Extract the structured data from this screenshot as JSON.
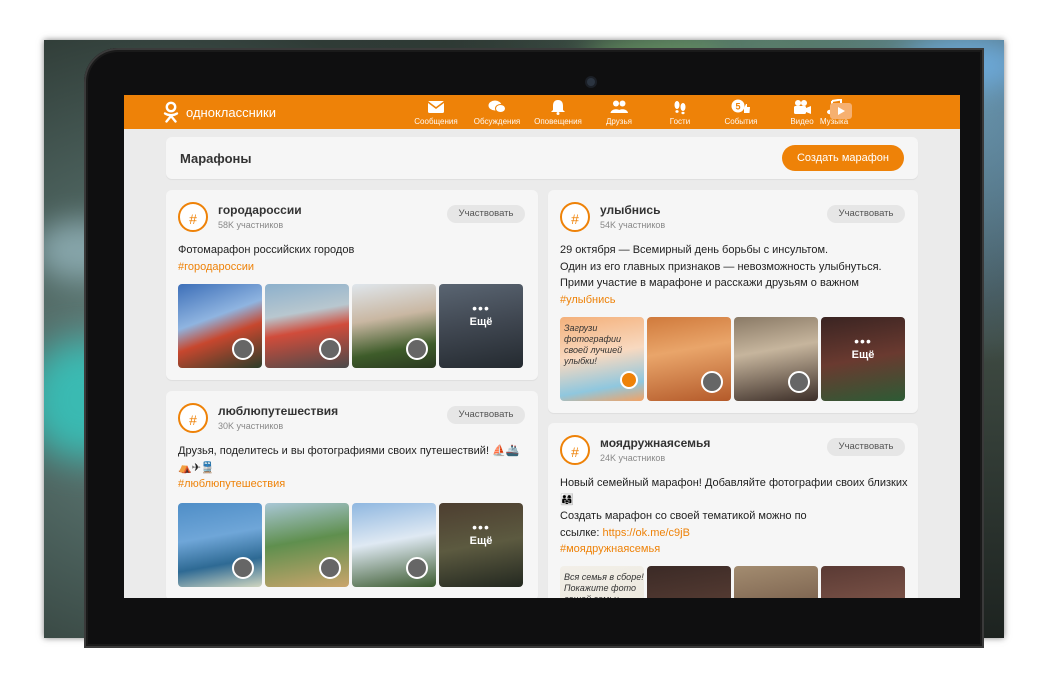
{
  "app": {
    "logo_text": "одноклассники",
    "brand_color": "#ee8208"
  },
  "nav": [
    {
      "label": "Сообщения",
      "icon": "envelope-icon"
    },
    {
      "label": "Обсуждения",
      "icon": "chat-bubbles-icon"
    },
    {
      "label": "Оповещения",
      "icon": "bell-icon"
    },
    {
      "label": "Друзья",
      "icon": "friends-icon"
    },
    {
      "label": "Гости",
      "icon": "footprints-icon"
    },
    {
      "label": "События",
      "icon": "events-icon",
      "badge": "5"
    },
    {
      "label": "Видео",
      "icon": "video-camera-icon"
    },
    {
      "label": "Музыка",
      "icon": "music-note-icon"
    }
  ],
  "page": {
    "title": "Марафоны",
    "create_button": "Создать марафон"
  },
  "cards": [
    {
      "name": "городароссии",
      "members": "58K участников",
      "join": "Участвовать",
      "desc_lines": [
        "Фотомарафон российских городов"
      ],
      "tag": "#городароссии",
      "more": "Ещё"
    },
    {
      "name": "улыбнись",
      "members": "54K участников",
      "join": "Участвовать",
      "desc_lines": [
        "29 октября —  Всемирный день борьбы с инсультом.",
        "Один из его главных признаков — невозможность улыбнуться.",
        "Прими участие в марафоне и расскажи друзьям о важном"
      ],
      "tag": "#улыбнись",
      "overlay": "Загрузи фотографии своей лучшей улыбки!",
      "more": "Ещё"
    },
    {
      "name": "люблюпутешествия",
      "members": "30K участников",
      "join": "Участвовать",
      "desc_lines": [
        "Друзья, поделитесь и вы фотографиями своих путешествий! ⛵🚢",
        "⛺✈🚆"
      ],
      "tag": "#люблюпутешествия",
      "more": "Ещё"
    },
    {
      "name": "моядружнаясемья",
      "members": "24K участников",
      "join": "Участвовать",
      "desc_lines": [
        "Новый семейный марафон! Добавляйте фотографии своих близких",
        "👨‍👩‍👧",
        "Создать марафон со своей тематикой можно по",
        "ссылке: "
      ],
      "link": "https://ok.me/c9jB",
      "tag": "#моядружнаясемья",
      "overlay": "Вся семья в сборе! Покажите фото вашей семьи"
    }
  ]
}
